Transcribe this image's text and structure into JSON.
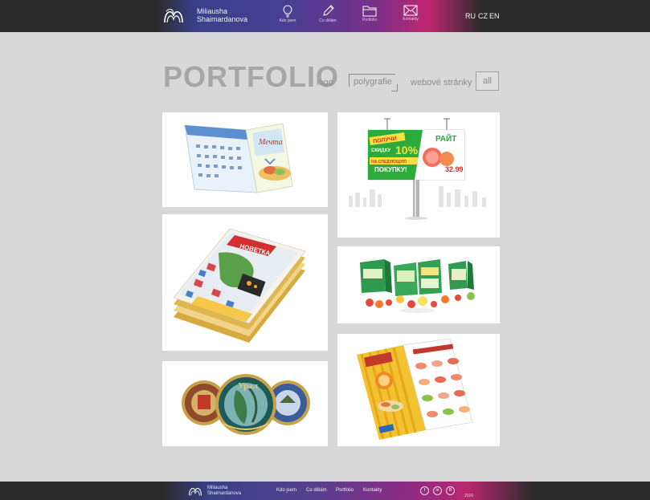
{
  "header": {
    "brand_line1": "Miliausha",
    "brand_line2": "Shaimardanova",
    "nav": [
      {
        "label": "Kdo jsem",
        "icon": "lightbulb-icon"
      },
      {
        "label": "Co dělám",
        "icon": "pencil-icon"
      },
      {
        "label": "Portfolio",
        "icon": "folder-icon"
      },
      {
        "label": "Kontakty",
        "icon": "envelope-icon"
      }
    ],
    "languages": [
      "RU",
      "CZ",
      "EN"
    ]
  },
  "portfolio": {
    "title": "PORTFOLIO",
    "filters": [
      "logo",
      "polygrafie",
      "webové stránky",
      "all"
    ],
    "tiles": [
      {
        "name": "calendar",
        "text": "Мечта"
      },
      {
        "name": "billboard",
        "text_a": "ПОЛУЧИ",
        "text_b": "СКИДКУ",
        "text_c": "10%",
        "text_d": "НА СЛЕДУЮЩУЮ",
        "text_e": "ПОКУПКУ!",
        "text_f": "РАЙТ",
        "text_g": "32.99"
      },
      {
        "name": "magazine-stack",
        "text": "НОВЕТКА"
      },
      {
        "name": "product-packaging"
      },
      {
        "name": "decorative-plates",
        "text": "Урал"
      },
      {
        "name": "menu-booklet"
      }
    ]
  },
  "footer": {
    "brand_line1": "Miliausha",
    "brand_line2": "Shaimardanova",
    "links": [
      "Kdo jsem",
      "Co dělám",
      "Portfolio",
      "Kontakty"
    ],
    "social": [
      {
        "icon": "facebook-icon",
        "glyph": "f"
      },
      {
        "icon": "linkedin-icon",
        "glyph": "in"
      },
      {
        "icon": "behance-icon",
        "glyph": "B"
      }
    ],
    "year": "2016"
  },
  "colors": {
    "bar": "#2b2b2b",
    "accent_blue": "#3b3f8a",
    "accent_purple": "#7a2f88",
    "accent_magenta": "#c0266f",
    "page_bg": "#d8d8d8",
    "title_grey": "#a6a6a6"
  }
}
